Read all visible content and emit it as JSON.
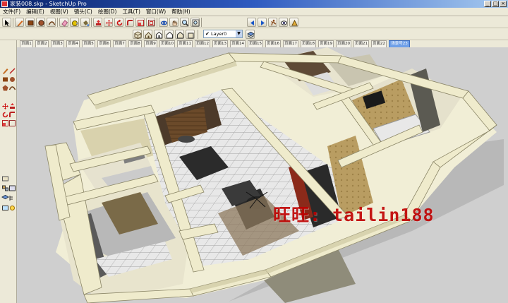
{
  "window": {
    "title": "家装008.skp - SketchUp Pro"
  },
  "menu": [
    {
      "label": "文件(F)"
    },
    {
      "label": "编辑(E)"
    },
    {
      "label": "视图(V)"
    },
    {
      "label": "镜头(C)"
    },
    {
      "label": "绘图(D)"
    },
    {
      "label": "工具(T)"
    },
    {
      "label": "窗口(W)"
    },
    {
      "label": "帮助(H)"
    }
  ],
  "layer_toolbar": {
    "current_layer": "Layer0"
  },
  "scene_tabs": [
    {
      "label": "页面1"
    },
    {
      "label": "页面2"
    },
    {
      "label": "页面3"
    },
    {
      "label": "页面4"
    },
    {
      "label": "页面5"
    },
    {
      "label": "页面6"
    },
    {
      "label": "页面7"
    },
    {
      "label": "页面8"
    },
    {
      "label": "页面9"
    },
    {
      "label": "页面10"
    },
    {
      "label": "页面11"
    },
    {
      "label": "页面12"
    },
    {
      "label": "页面13"
    },
    {
      "label": "页面14"
    },
    {
      "label": "页面15"
    },
    {
      "label": "页面16"
    },
    {
      "label": "页面17"
    },
    {
      "label": "页面18"
    },
    {
      "label": "页面19"
    },
    {
      "label": "页面20"
    },
    {
      "label": "页面21"
    },
    {
      "label": "页面22"
    },
    {
      "label": "场景号23"
    }
  ],
  "active_tab_index": 22,
  "watermark": "旺旺: tailin188",
  "colors": {
    "wall": "#ede9c8",
    "wall_shadow": "#cfc9a3",
    "viewport_bg": "#cfcfcf",
    "watermark": "#c00000",
    "active_tab": "#6fa0e8"
  },
  "icons": {
    "top_toolbar": [
      "select-icon",
      "pencil-icon",
      "rectangle-icon",
      "circle-icon",
      "arc-icon",
      "eraser-icon",
      "tape-measure-icon",
      "paint-bucket-icon",
      "push-pull-icon",
      "move-icon",
      "rotate-icon",
      "follow-me-icon",
      "scale-icon",
      "offset-icon",
      "orbit-icon",
      "pan-icon",
      "zoom-icon",
      "zoom-extents-icon",
      "previous-view-icon",
      "next-view-icon",
      "walk-icon",
      "look-around-icon",
      "position-camera-icon",
      "section-plane-icon",
      "3d-warehouse-icon",
      "components-icon"
    ],
    "second_toolbar": [
      "iso-view-icon",
      "top-view-icon",
      "front-view-icon",
      "right-view-icon",
      "back-view-icon",
      "left-view-icon",
      "layer-icon",
      "layer-manager-icon"
    ]
  }
}
